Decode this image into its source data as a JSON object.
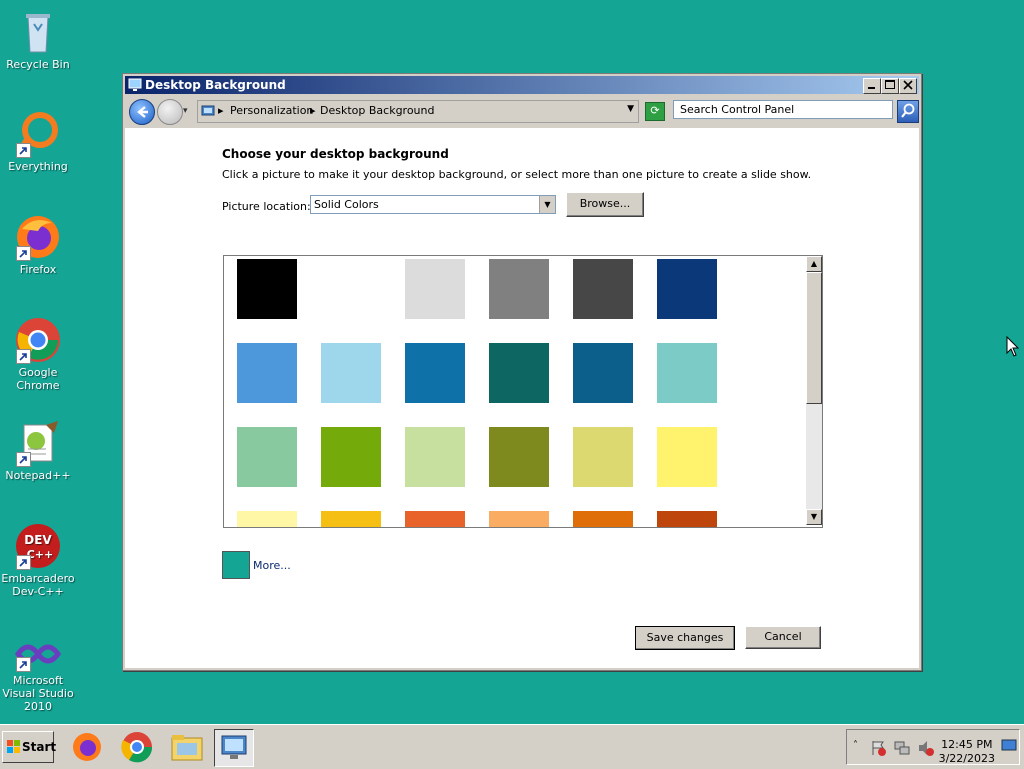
{
  "desktop": {
    "icons": [
      {
        "label": "Recycle Bin"
      },
      {
        "label": "Everything"
      },
      {
        "label": "Firefox"
      },
      {
        "label": "Google Chrome"
      },
      {
        "label": "Notepad++"
      },
      {
        "label": "Embarcadero Dev-C++"
      },
      {
        "label": "Microsoft Visual Studio 2010"
      }
    ]
  },
  "window": {
    "title": "Desktop Background",
    "address": {
      "breadcrumbs": [
        "Personalization",
        "Desktop Background"
      ]
    },
    "search_placeholder": "Search Control Panel",
    "heading": "Choose your desktop background",
    "subtext": "Click a picture to make it your desktop background, or select more than one picture to create a slide show.",
    "picture_location_label": "Picture location:",
    "picture_location_value": "Solid Colors",
    "browse_label": "Browse...",
    "swatches": [
      "#000000",
      "#ffffff",
      "#dcdcdc",
      "#808080",
      "#474747",
      "#0a3878",
      "#4c98da",
      "#9ed7ec",
      "#0e72a8",
      "#0d6661",
      "#0b5f8a",
      "#7ccbc6",
      "#88c9a0",
      "#74aa0a",
      "#c7e0a0",
      "#7e8a1e",
      "#dbd96f",
      "#fff36e",
      "#fff6a6",
      "#f6bf14",
      "#e8632a",
      "#f9ac62",
      "#e06e08",
      "#be450c"
    ],
    "more_label": "More...",
    "more_color": "#14a595",
    "save_label": "Save changes",
    "cancel_label": "Cancel"
  },
  "taskbar": {
    "start_label": "Start",
    "clock_time": "12:45 PM",
    "clock_date": "3/22/2023"
  }
}
